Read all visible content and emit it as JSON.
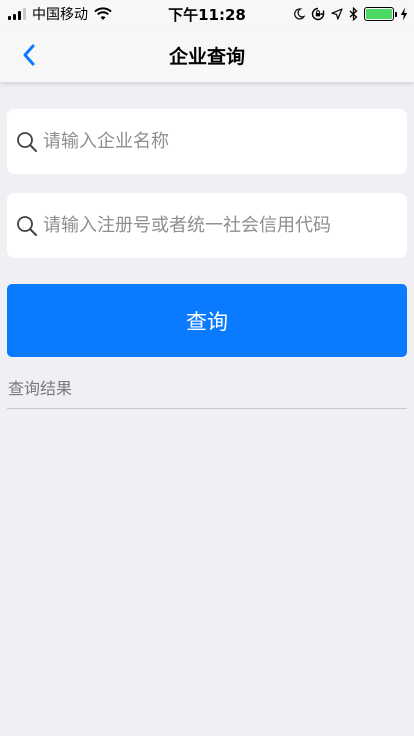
{
  "status_bar": {
    "carrier": "中国移动",
    "time": "下午11:28",
    "battery_color": "#4cd964",
    "icons": [
      "signal-icon",
      "wifi-icon",
      "moon-icon",
      "lock-rotation-icon",
      "location-icon",
      "bluetooth-icon",
      "battery-icon",
      "charging-icon"
    ]
  },
  "nav": {
    "title": "企业查询",
    "back_icon": "chevron-left-icon",
    "accent_color": "#0a7aff"
  },
  "form": {
    "company_name_placeholder": "请输入企业名称",
    "registration_code_placeholder": "请输入注册号或者统一社会信用代码",
    "search_icon": "search-icon",
    "query_button_label": "查询",
    "button_color": "#0a7aff"
  },
  "results": {
    "label": "查询结果"
  }
}
